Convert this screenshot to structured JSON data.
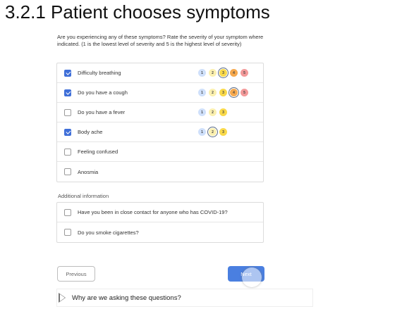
{
  "page": {
    "heading": "3.2.1 Patient chooses symptoms",
    "intro": "Are you experiencing any of these symptoms? Rate the severity of your symptom where indicated. (1 is the lowest level of severity and 5 is the highest level of severity)"
  },
  "colors": {
    "sev1": "#cfe0fb",
    "sev2": "#fbf0b0",
    "sev3": "#f9d94a",
    "sev4": "#f6a94e",
    "sev5": "#f39a9a",
    "primary": "#4a7fe0",
    "checkbox": "#3f6fd8"
  },
  "symptoms": [
    {
      "label": "Difficulty breathing",
      "checked": true,
      "levels": [
        "1",
        "2",
        "3",
        "4",
        "5"
      ],
      "selected": "3"
    },
    {
      "label": "Do you have a cough",
      "checked": true,
      "levels": [
        "1",
        "2",
        "3",
        "4",
        "5"
      ],
      "selected": "4"
    },
    {
      "label": "Do you have a fever",
      "checked": false,
      "levels": [
        "1",
        "2",
        "3"
      ],
      "selected": null
    },
    {
      "label": "Body ache",
      "checked": true,
      "levels": [
        "1",
        "2",
        "3"
      ],
      "selected": "2"
    },
    {
      "label": "Feeling confused",
      "checked": false,
      "levels": [],
      "selected": null
    },
    {
      "label": "Anosmia",
      "checked": false,
      "levels": [],
      "selected": null
    }
  ],
  "additional": {
    "title": "Additional information",
    "items": [
      {
        "label": "Have you been in close contact for anyone who has COVID-19?",
        "checked": false
      },
      {
        "label": "Do you smoke cigarettes?",
        "checked": false
      }
    ]
  },
  "buttons": {
    "previous": "Previous",
    "next": "Next"
  },
  "why": {
    "text": "Why are we asking these questions?"
  }
}
